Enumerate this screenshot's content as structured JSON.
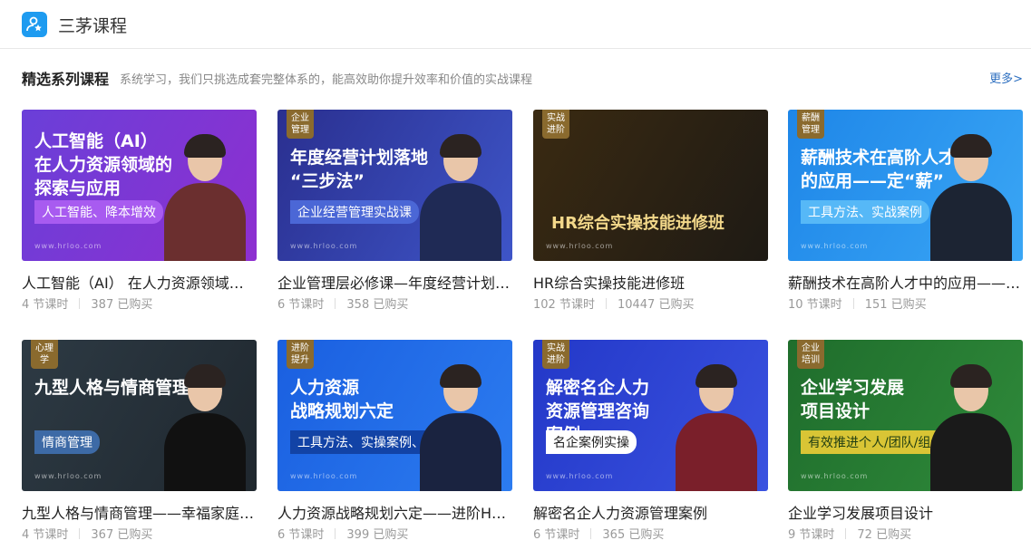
{
  "app": {
    "title": "三茅课程",
    "logo_icon": "person-star-icon"
  },
  "section": {
    "title": "精选系列课程",
    "desc": "系统学习，我们只挑选成套完整体系的，能高效助你提升效率和价值的实战课程",
    "more": "更多>"
  },
  "courses": [
    {
      "title": "人工智能（AI） 在人力资源领域的探索与应用",
      "lessons": "4 节课时",
      "buyers": "387 已购买",
      "thumb": {
        "headline": "人工智能（AI）\n在人力资源领域的\n探索与应用",
        "tagline": "人工智能、降本增效",
        "badge": "",
        "watermark": "www.hrloo.com",
        "bg": "#6a3fd8",
        "bg2": "#8e2fd0",
        "tag_bg": "#a85bf0",
        "body_color": "#6b2f2f"
      }
    },
    {
      "title": "企业管理层必修课—年度经营计划落地“三步法”",
      "lessons": "6 节课时",
      "buyers": "358 已购买",
      "thumb": {
        "headline": "年度经营计划落地\n“三步法”",
        "tagline": "企业经营管理实战课",
        "badge": "企业\n管理",
        "watermark": "www.hrloo.com",
        "bg": "#2a2f8f",
        "bg2": "#3e55c8",
        "tag_bg": "#4b67d6",
        "body_color": "#1f2a55"
      }
    },
    {
      "title": "HR综合实操技能进修班",
      "lessons": "102 节课时",
      "buyers": "10447 已购买",
      "thumb": {
        "headline": "",
        "tagline": "HR综合实操技能进修班",
        "badge": "实战\n进阶",
        "watermark": "www.hrloo.com",
        "bg": "#3a2a12",
        "bg2": "#1e1a14",
        "tag_bg": "#2a1f10",
        "body_color": "#222"
      }
    },
    {
      "title": "薪酬技术在高阶人才中的应用——定“薪”",
      "lessons": "10 节课时",
      "buyers": "151 已购买",
      "thumb": {
        "headline": "薪酬技术在高阶人才中\n的应用——定“薪”",
        "tagline": "工具方法、实战案例",
        "badge": "薪酬\n管理",
        "watermark": "www.hrloo.com",
        "bg": "#1e86e8",
        "bg2": "#3aa6f5",
        "tag_bg": "#56b8f7",
        "body_color": "#1c2433"
      }
    },
    {
      "title": "九型人格与情商管理——幸福家庭、职场秘籍课",
      "lessons": "4 节课时",
      "buyers": "367 已购买",
      "thumb": {
        "headline": "九型人格与情商管理",
        "tagline": "情商管理",
        "badge": "心理学",
        "watermark": "www.hrloo.com",
        "bg": "#2d3a44",
        "bg2": "#1f272e",
        "tag_bg": "#3d6aa6",
        "body_color": "#111"
      }
    },
    {
      "title": "人力资源战略规划六定——进阶HR管理层的第一课",
      "lessons": "6 节课时",
      "buyers": "399 已购买",
      "thumb": {
        "headline": "人力资源\n战略规划六定",
        "tagline": "工具方法、实操案例、设计策略",
        "badge": "进阶\n提升",
        "watermark": "www.hrloo.com",
        "bg": "#1a5fe0",
        "bg2": "#2c7cf0",
        "tag_bg": "#1243a6",
        "body_color": "#1a2340"
      }
    },
    {
      "title": "解密名企人力资源管理案例",
      "lessons": "6 节课时",
      "buyers": "365 已购买",
      "thumb": {
        "headline": "解密名企人力\n资源管理咨询\n案例",
        "tagline": "名企案例实操",
        "badge": "实战\n进阶",
        "watermark": "www.hrloo.com",
        "bg": "#2338c8",
        "bg2": "#3a52e0",
        "tag_bg": "#ffffff",
        "body_color": "#7a1f2a"
      }
    },
    {
      "title": "企业学习发展项目设计",
      "lessons": "9 节课时",
      "buyers": "72 已购买",
      "thumb": {
        "headline": "企业学习发展\n项目设计",
        "tagline": "有效推进个人/团队/组织目标落地",
        "badge": "企业\n培训",
        "watermark": "www.hrloo.com",
        "bg": "#1f6d2c",
        "bg2": "#2f8a3a",
        "tag_bg": "#d9c535",
        "body_color": "#1a1a1a"
      }
    }
  ]
}
